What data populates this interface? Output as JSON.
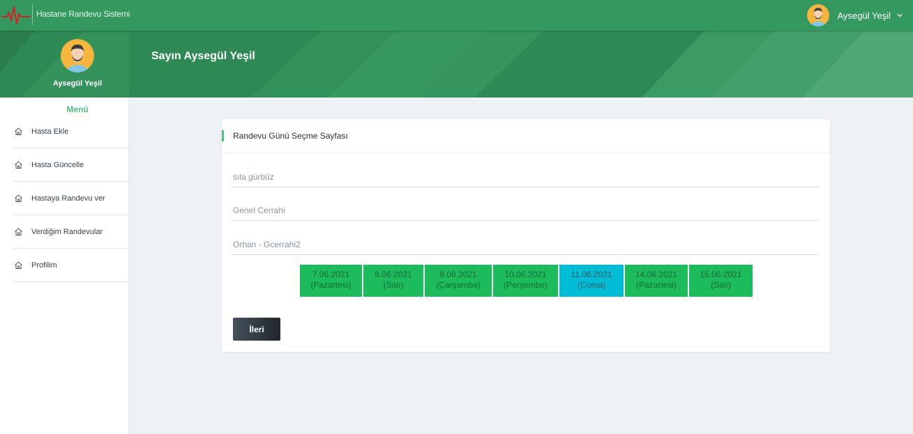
{
  "header": {
    "app_title": "Hastane Randevu Sistemi",
    "user_name": "Aysegül Yeşil"
  },
  "hero": {
    "greeting": "Sayın Aysegül Yeşil"
  },
  "sidebar": {
    "profile_name": "Aysegül Yeşil",
    "menu_title": "Menü",
    "items": [
      {
        "label": "Hasta Ekle",
        "icon": "home-icon"
      },
      {
        "label": "Hasta Güncelle",
        "icon": "home-icon"
      },
      {
        "label": "Hastaya Randevu ver",
        "icon": "home-icon"
      },
      {
        "label": "Verdiğim Randevular",
        "icon": "home-icon"
      },
      {
        "label": "Profilim",
        "icon": "home-icon"
      }
    ]
  },
  "card": {
    "title": "Randevu Günü Seçme Sayfası",
    "patient": "sıla gürbüz",
    "department": "Genel Cerrahi",
    "doctor": "Orhan - Gcerrahi2",
    "dates": [
      {
        "date": "7.06.2021",
        "day": "(Pazartesi)",
        "selected": false
      },
      {
        "date": "8.06.2021",
        "day": "(Salı)",
        "selected": false
      },
      {
        "date": "9.06.2021",
        "day": "(Çarşamba)",
        "selected": false
      },
      {
        "date": "10.06.2021",
        "day": "(Perşembe)",
        "selected": false
      },
      {
        "date": "11.06.2021",
        "day": "(Cuma)",
        "selected": true
      },
      {
        "date": "14.06.2021",
        "day": "(Pazartesi)",
        "selected": false
      },
      {
        "date": "15.06.2021",
        "day": "(Salı)",
        "selected": false
      }
    ],
    "next_label": "İleri"
  },
  "colors": {
    "topbar": "#34995f",
    "hero": "#2e8a55",
    "accent": "#4cc282",
    "date_default": "#1cbb5c",
    "date_selected": "#00bcd4",
    "button_dark": "#2c343b"
  }
}
